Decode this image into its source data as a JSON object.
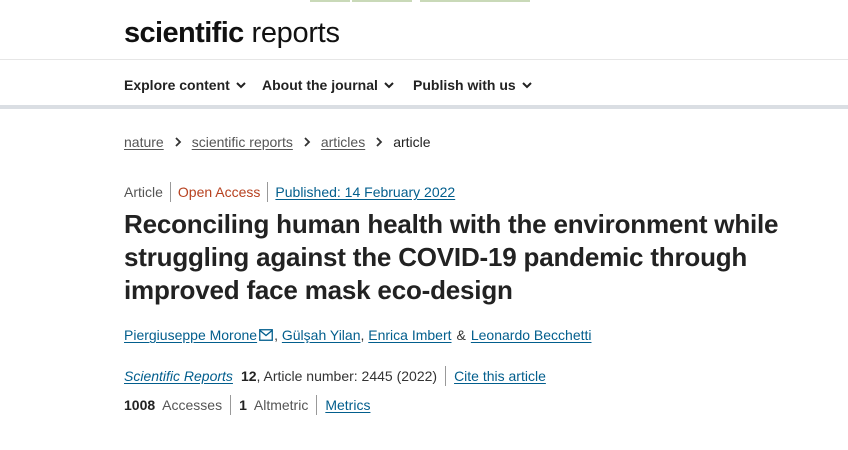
{
  "header": {
    "logo_bold": "scientific",
    "logo_light": "reports"
  },
  "nav": {
    "items": [
      {
        "label": "Explore content"
      },
      {
        "label": "About the journal"
      },
      {
        "label": "Publish with us"
      }
    ]
  },
  "breadcrumb": {
    "items": [
      "nature",
      "scientific reports",
      "articles"
    ],
    "current": "article"
  },
  "article": {
    "type": "Article",
    "access": "Open Access",
    "published": "Published: 14 February 2022",
    "title": "Reconciling human health with the environment while struggling against the COVID-19 pandemic through improved face mask eco-design",
    "authors": [
      "Piergiuseppe Morone",
      "Gülşah Yilan",
      "Enrica Imbert",
      "Leonardo Becchetti"
    ],
    "author_separator": ",",
    "author_ampersand": "&",
    "journal": "Scientific Reports",
    "volume": "12",
    "article_number_text": ", Article number: 2445 (2022)",
    "cite_label": "Cite this article"
  },
  "metrics": {
    "accesses_count": "1008",
    "accesses_label": "Accesses",
    "altmetric_count": "1",
    "altmetric_label": "Altmetric",
    "metrics_link": "Metrics"
  },
  "colors": {
    "link": "#025e8d",
    "open_access": "#b7411f",
    "text": "#222222",
    "nav_border": "#dadee3"
  },
  "icons": {
    "nav_chevron": "chevron-down-icon",
    "breadcrumb_separator": "chevron-right-icon",
    "author_contact": "envelope-icon"
  }
}
